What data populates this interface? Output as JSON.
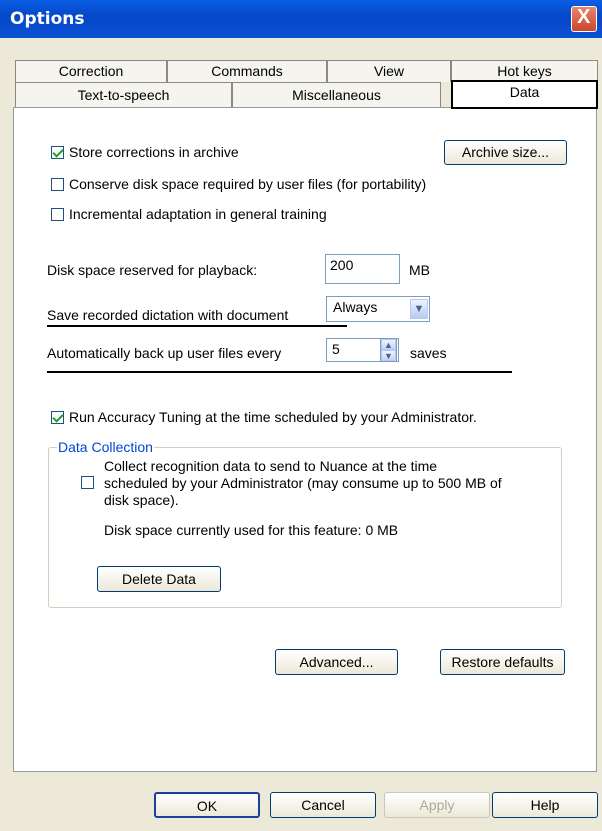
{
  "window": {
    "title": "Options",
    "close_label": "X"
  },
  "tabs": {
    "correction": "Correction",
    "commands": "Commands",
    "view": "View",
    "hotkeys": "Hot keys",
    "tts": "Text-to-speech",
    "misc": "Miscellaneous",
    "data": "Data"
  },
  "options": {
    "store_corrections": {
      "label": "Store corrections in archive",
      "checked": true
    },
    "archive_button": "Archive size...",
    "conserve": {
      "label": "Conserve disk space required by user files (for portability)",
      "checked": false
    },
    "incremental": {
      "label": "Incremental adaptation in general training",
      "checked": false
    },
    "disk_space_label": "Disk space reserved for playback:",
    "disk_space_value": "200",
    "disk_space_unit": "MB",
    "save_recorded_label": "Save recorded dictation with document",
    "save_recorded_value": "Always",
    "backup_label": "Automatically back up user files every",
    "backup_value": "5",
    "backup_unit": "saves",
    "accuracy": {
      "label": "Run Accuracy Tuning at the time scheduled by your Administrator.",
      "checked": true
    }
  },
  "data_collection": {
    "group_title": "Data Collection",
    "collect_line1": "Collect recognition data to send to Nuance at the time",
    "collect_line2": "scheduled by your Administrator (may consume up to 500 MB of",
    "collect_line3": "disk space).",
    "collect_checked": false,
    "disk_used": "Disk space currently used for this feature: 0 MB",
    "delete_button": "Delete Data"
  },
  "panel_buttons": {
    "advanced": "Advanced...",
    "restore": "Restore defaults"
  },
  "dialog_buttons": {
    "ok": "OK",
    "cancel": "Cancel",
    "apply": "Apply",
    "help": "Help"
  }
}
